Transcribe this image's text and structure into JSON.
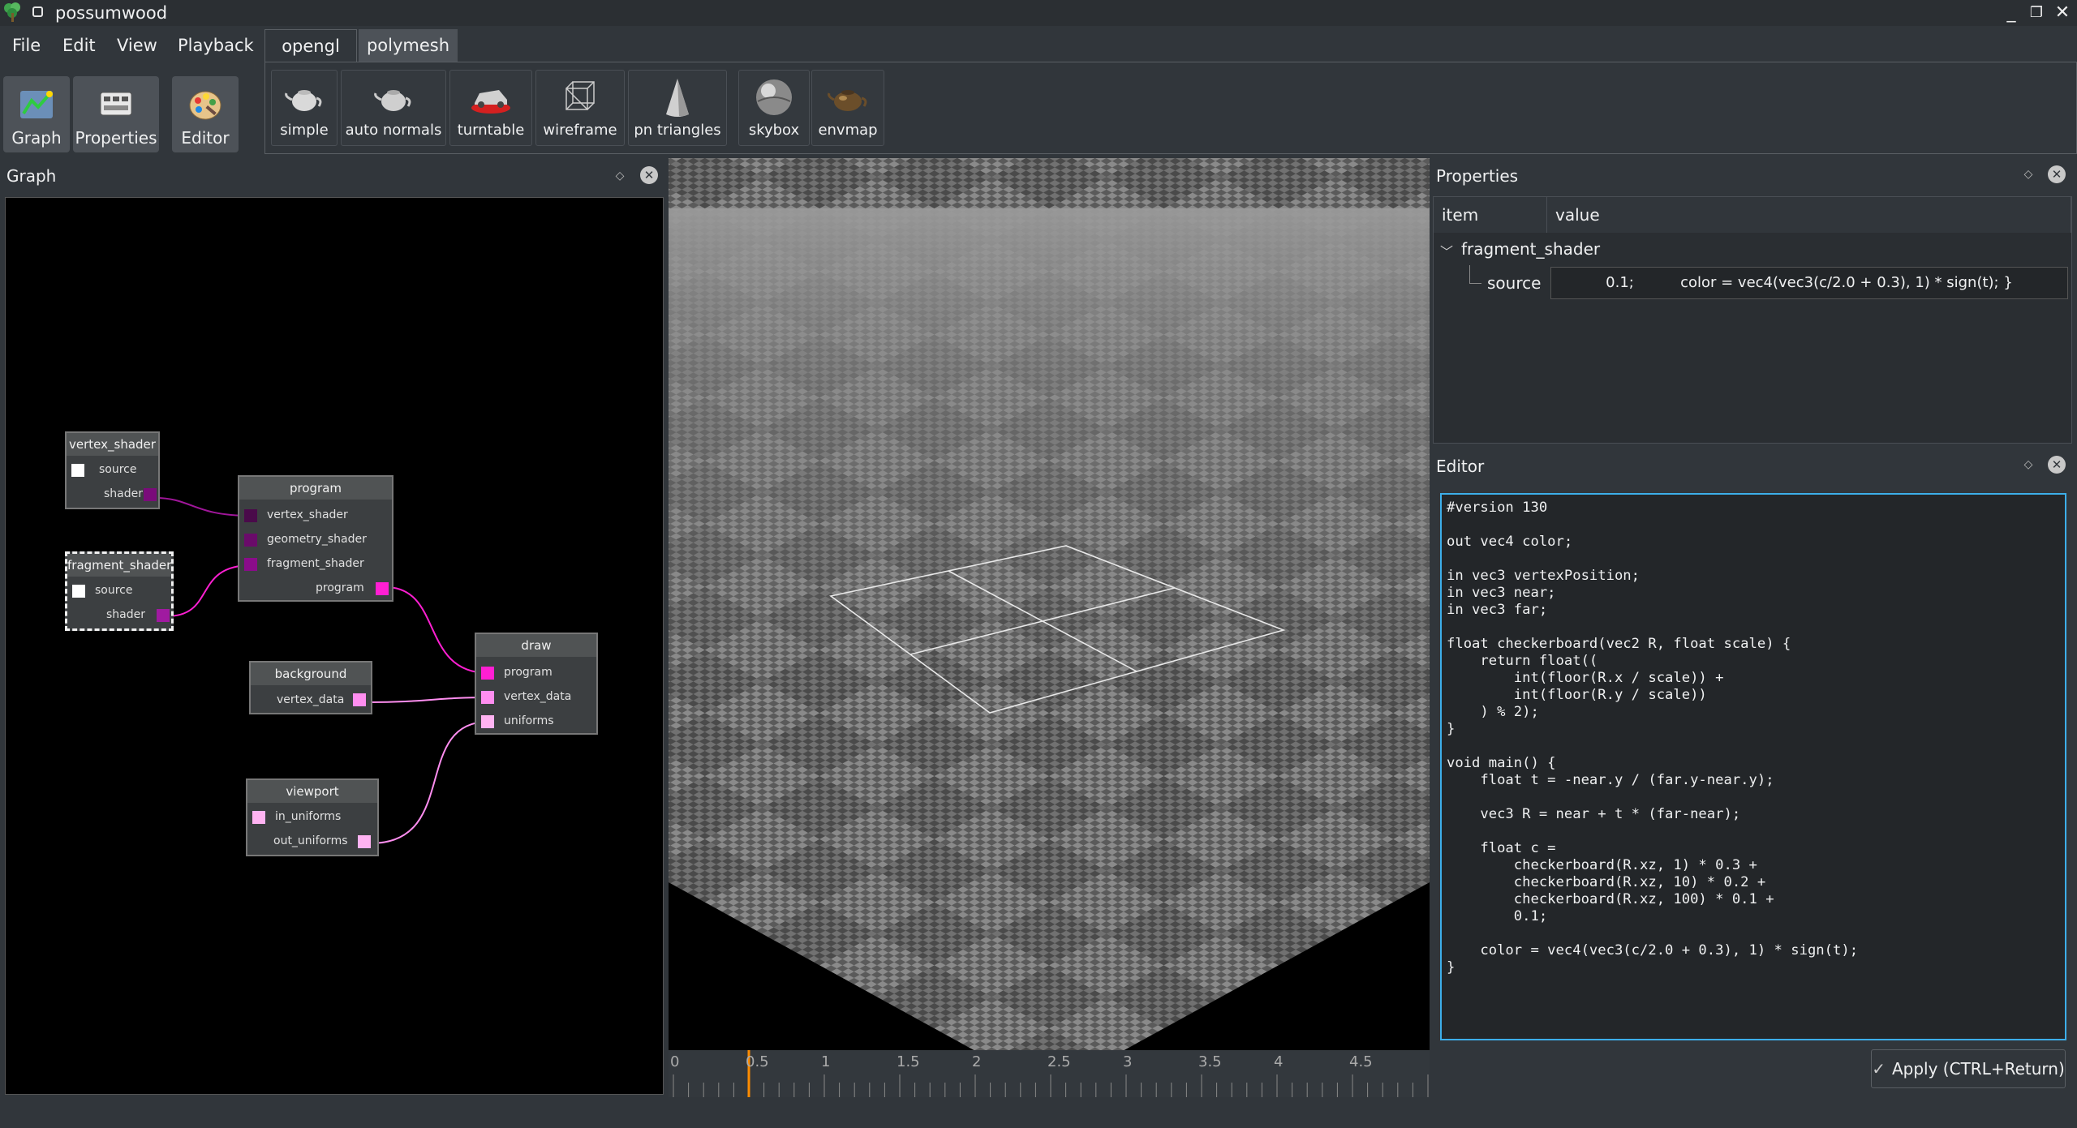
{
  "app": {
    "title": "possumwood"
  },
  "window_controls": {
    "minimize": "_",
    "maximize": "❐",
    "close": "✕"
  },
  "menu": [
    "File",
    "Edit",
    "View",
    "Playback"
  ],
  "big_toolbar": [
    {
      "label": "Graph",
      "icon": "graph-icon"
    },
    {
      "label": "Properties",
      "icon": "properties-icon"
    },
    {
      "label": "Editor",
      "icon": "editor-palette-icon"
    }
  ],
  "tabs": [
    {
      "label": "opengl",
      "active": false
    },
    {
      "label": "polymesh",
      "active": true
    }
  ],
  "tool_buttons": [
    {
      "label": "simple",
      "icon": "teapot-icon"
    },
    {
      "label": "auto normals",
      "icon": "teapot-normals-icon"
    },
    {
      "label": "turntable",
      "icon": "car-turntable-icon"
    },
    {
      "label": "wireframe",
      "icon": "wireframe-cube-icon"
    },
    {
      "label": "pn triangles",
      "icon": "cone-icon"
    },
    {
      "label": "skybox",
      "icon": "sphere-icon"
    },
    {
      "label": "envmap",
      "icon": "envmap-icon"
    }
  ],
  "graph": {
    "title": "Graph",
    "nodes": {
      "vertex_shader": {
        "title": "vertex_shader",
        "ports": [
          "source",
          "shader"
        ]
      },
      "fragment_shader": {
        "title": "fragment_shader",
        "ports": [
          "source",
          "shader"
        ]
      },
      "program": {
        "title": "program",
        "ports": [
          "vertex_shader",
          "geometry_shader",
          "fragment_shader",
          "program"
        ]
      },
      "background": {
        "title": "background",
        "ports": [
          "vertex_data"
        ]
      },
      "draw": {
        "title": "draw",
        "ports": [
          "program",
          "vertex_data",
          "uniforms"
        ]
      },
      "viewport": {
        "title": "viewport",
        "ports": [
          "in_uniforms",
          "out_uniforms"
        ]
      }
    }
  },
  "timeline": {
    "ticks": [
      "0",
      "0.5",
      "1",
      "1.5",
      "2",
      "2.5",
      "3",
      "3.5",
      "4",
      "4.5"
    ],
    "current": 0.5,
    "cursor_color": "#ff8c00"
  },
  "properties": {
    "title": "Properties",
    "headers": [
      "item",
      "value"
    ],
    "node": "fragment_shader",
    "row": {
      "item": "source",
      "value": "0.1;          color = vec4(vec3(c/2.0 + 0.3), 1) * sign(t); }"
    }
  },
  "editor": {
    "title": "Editor",
    "code": "#version 130\n\nout vec4 color;\n\nin vec3 vertexPosition;\nin vec3 near;\nin vec3 far;\n\nfloat checkerboard(vec2 R, float scale) {\n    return float((\n        int(floor(R.x / scale)) +\n        int(floor(R.y / scale))\n    ) % 2);\n}\n\nvoid main() {\n    float t = -near.y / (far.y-near.y);\n\n    vec3 R = near + t * (far-near);\n\n    float c =\n        checkerboard(R.xz, 1) * 0.3 +\n        checkerboard(R.xz, 10) * 0.2 +\n        checkerboard(R.xz, 100) * 0.1 +\n        0.1;\n\n    color = vec4(vec3(c/2.0 + 0.3), 1) * sign(t);\n}",
    "apply_label": "Apply (CTRL+Return)",
    "apply_icon": "checkmark-icon"
  },
  "colors": {
    "accent": "#3daee9",
    "port_magenta": "#ff1fd2",
    "port_purple": "#8a0c8a",
    "port_pink": "#ffb3f2",
    "link_purple": "#a0169a",
    "link_pink": "#ff8ef0"
  }
}
